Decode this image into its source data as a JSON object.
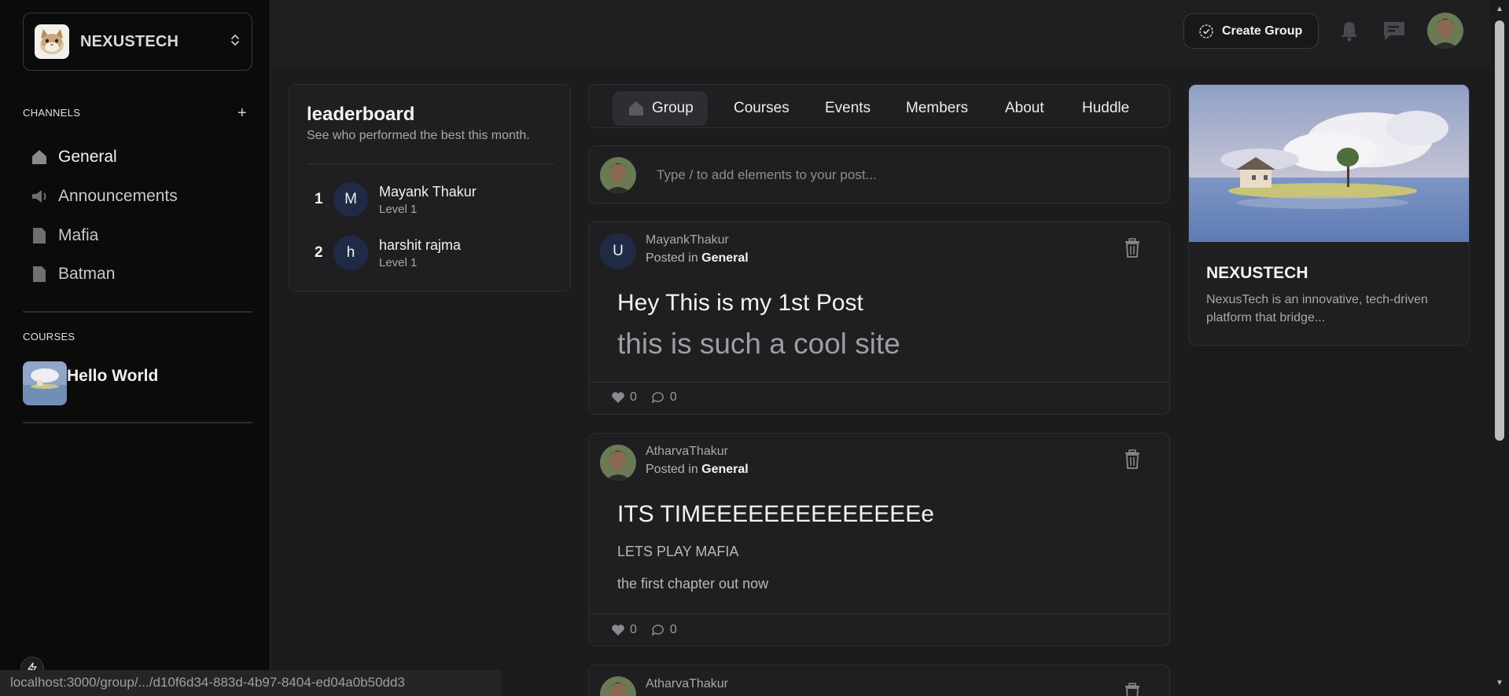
{
  "workspace": {
    "name": "NEXUSTECH"
  },
  "sidebar": {
    "channels_heading": "CHANNELS",
    "channels": [
      {
        "label": "General",
        "icon": "home-icon",
        "active": true
      },
      {
        "label": "Announcements",
        "icon": "megaphone-icon",
        "active": false
      },
      {
        "label": "Mafia",
        "icon": "file-icon",
        "active": false
      },
      {
        "label": "Batman",
        "icon": "file-icon",
        "active": false
      }
    ],
    "courses_heading": "COURSES",
    "courses": [
      {
        "label": "Hello World"
      }
    ]
  },
  "topbar": {
    "create_group_label": "Create Group"
  },
  "leaderboard": {
    "title": "leaderboard",
    "subtitle": "See who performed the best this month.",
    "entries": [
      {
        "rank": "1",
        "initial": "M",
        "name": "Mayank Thakur",
        "level": "Level 1"
      },
      {
        "rank": "2",
        "initial": "h",
        "name": "harshit rajma",
        "level": "Level 1"
      }
    ]
  },
  "tabs": [
    {
      "label": "Group",
      "active": true
    },
    {
      "label": "Courses"
    },
    {
      "label": "Events"
    },
    {
      "label": "Members"
    },
    {
      "label": "About"
    },
    {
      "label": "Huddle"
    }
  ],
  "composer": {
    "placeholder": "Type / to add elements to your post..."
  },
  "posts": [
    {
      "author": "MayankThakur",
      "avatar_initial": "U",
      "posted_in_prefix": "Posted in",
      "channel": "General",
      "title": "Hey This is my 1st Post",
      "body": [
        "this is such a cool site"
      ],
      "likes": "0",
      "comments": "0"
    },
    {
      "author": "AtharvaThakur",
      "posted_in_prefix": "Posted in",
      "channel": "General",
      "title": "ITS TIMEEEEEEEEEEEEEEe",
      "body": [
        "LETS PLAY MAFIA",
        "the first chapter out now"
      ],
      "likes": "0",
      "comments": "0"
    },
    {
      "author": "AtharvaThakur"
    }
  ],
  "group_info": {
    "name": "NEXUSTECH",
    "description": "NexusTech is an innovative, tech-driven platform that bridge..."
  },
  "status_bar": {
    "url": "localhost:3000/group/.../d10f6d34-883d-4b97-8404-ed04a0b50dd3"
  },
  "colors": {
    "background": "#1c1c1e",
    "sidebar": "#0b0b0c",
    "card": "#1f1f21",
    "avatar_blue": "#1f2b45"
  }
}
